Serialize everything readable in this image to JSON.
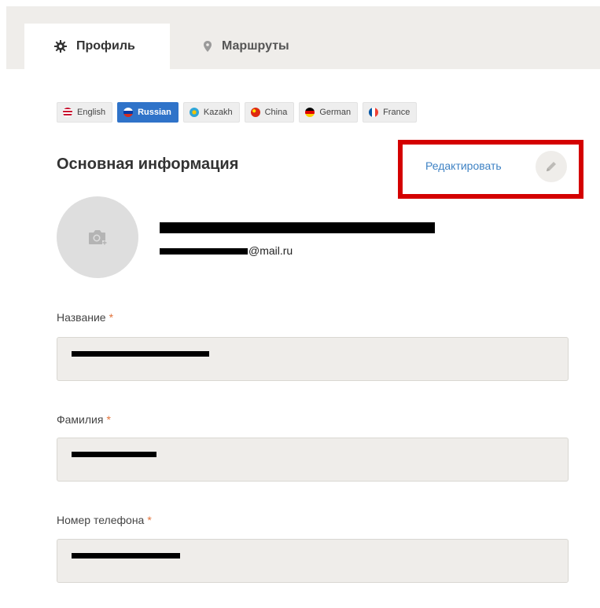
{
  "tabs": [
    {
      "label": "Профиль",
      "icon": "gear-icon",
      "active": true
    },
    {
      "label": "Маршруты",
      "icon": "location-pin-icon",
      "active": false
    }
  ],
  "languages": [
    {
      "label": "English",
      "flag": "us-flag-icon",
      "active": false
    },
    {
      "label": "Russian",
      "flag": "russia-flag-icon",
      "active": true
    },
    {
      "label": "Kazakh",
      "flag": "kazakhstan-flag-icon",
      "active": false
    },
    {
      "label": "China",
      "flag": "china-flag-icon",
      "active": false
    },
    {
      "label": "German",
      "flag": "germany-flag-icon",
      "active": false
    },
    {
      "label": "France",
      "flag": "france-flag-icon",
      "active": false
    }
  ],
  "section": {
    "title": "Основная информация",
    "edit_label": "Редактировать"
  },
  "user": {
    "email_suffix": "@mail.ru"
  },
  "form": {
    "name_label": "Название",
    "surname_label": "Фамилия",
    "phone_label": "Номер телефона",
    "required_mark": "*"
  },
  "colors": {
    "accent": "#2f73c9",
    "link": "#3e82c4",
    "highlight": "#d40000",
    "required": "#e2733b"
  }
}
